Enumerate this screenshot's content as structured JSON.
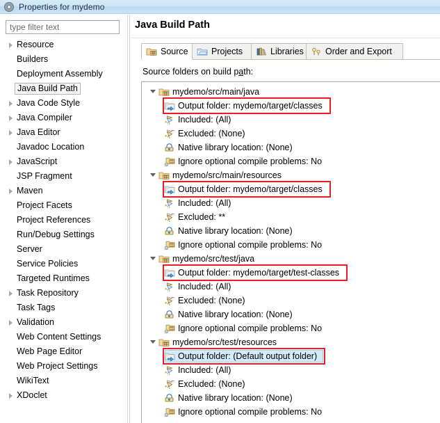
{
  "window": {
    "title": "Properties for mydemo",
    "icon": "properties-gear-icon"
  },
  "sidebar": {
    "filter": {
      "placeholder": "type filter text",
      "value": ""
    },
    "items": [
      {
        "label": "Resource",
        "expandable": true,
        "selected": false
      },
      {
        "label": "Builders",
        "expandable": false,
        "selected": false
      },
      {
        "label": "Deployment Assembly",
        "expandable": false,
        "selected": false
      },
      {
        "label": "Java Build Path",
        "expandable": false,
        "selected": true
      },
      {
        "label": "Java Code Style",
        "expandable": true,
        "selected": false
      },
      {
        "label": "Java Compiler",
        "expandable": true,
        "selected": false
      },
      {
        "label": "Java Editor",
        "expandable": true,
        "selected": false
      },
      {
        "label": "Javadoc Location",
        "expandable": false,
        "selected": false
      },
      {
        "label": "JavaScript",
        "expandable": true,
        "selected": false
      },
      {
        "label": "JSP Fragment",
        "expandable": false,
        "selected": false
      },
      {
        "label": "Maven",
        "expandable": true,
        "selected": false
      },
      {
        "label": "Project Facets",
        "expandable": false,
        "selected": false
      },
      {
        "label": "Project References",
        "expandable": false,
        "selected": false
      },
      {
        "label": "Run/Debug Settings",
        "expandable": false,
        "selected": false
      },
      {
        "label": "Server",
        "expandable": false,
        "selected": false
      },
      {
        "label": "Service Policies",
        "expandable": false,
        "selected": false
      },
      {
        "label": "Targeted Runtimes",
        "expandable": false,
        "selected": false
      },
      {
        "label": "Task Repository",
        "expandable": true,
        "selected": false
      },
      {
        "label": "Task Tags",
        "expandable": false,
        "selected": false
      },
      {
        "label": "Validation",
        "expandable": true,
        "selected": false
      },
      {
        "label": "Web Content Settings",
        "expandable": false,
        "selected": false
      },
      {
        "label": "Web Page Editor",
        "expandable": false,
        "selected": false
      },
      {
        "label": "Web Project Settings",
        "expandable": false,
        "selected": false
      },
      {
        "label": "WikiText",
        "expandable": false,
        "selected": false
      },
      {
        "label": "XDoclet",
        "expandable": true,
        "selected": false
      }
    ]
  },
  "page": {
    "title": "Java Build Path",
    "tabs": [
      {
        "label": "Source",
        "icon": "source-folder-icon",
        "active": true
      },
      {
        "label": "Projects",
        "icon": "project-folder-icon",
        "active": false
      },
      {
        "label": "Libraries",
        "icon": "library-books-icon",
        "active": false
      },
      {
        "label": "Order and Export",
        "icon": "order-export-icon",
        "active": false
      }
    ],
    "section_label_pre": "Source folders on build p",
    "section_label_mnemonic": "a",
    "section_label_post": "th:",
    "tree": [
      {
        "label": "mydemo/src/main/java",
        "icon": "source-folder-icon",
        "level": 0,
        "expanded": true,
        "children": [
          {
            "label": "Output folder: mydemo/target/classes",
            "icon": "output-folder-icon",
            "highlight": true,
            "selected": false
          },
          {
            "label": "Included: (All)",
            "icon": "included-icon",
            "highlight": false,
            "selected": false
          },
          {
            "label": "Excluded: (None)",
            "icon": "excluded-icon",
            "highlight": false,
            "selected": false
          },
          {
            "label": "Native library location: (None)",
            "icon": "native-library-icon",
            "highlight": false,
            "selected": false
          },
          {
            "label": "Ignore optional compile problems: No",
            "icon": "compile-problems-icon",
            "highlight": false,
            "selected": false
          }
        ]
      },
      {
        "label": "mydemo/src/main/resources",
        "icon": "source-folder-icon",
        "level": 0,
        "expanded": true,
        "children": [
          {
            "label": "Output folder: mydemo/target/classes",
            "icon": "output-folder-icon",
            "highlight": true,
            "selected": false
          },
          {
            "label": "Included: (All)",
            "icon": "included-icon",
            "highlight": false,
            "selected": false
          },
          {
            "label": "Excluded: **",
            "icon": "excluded-icon",
            "highlight": false,
            "selected": false
          },
          {
            "label": "Native library location: (None)",
            "icon": "native-library-icon",
            "highlight": false,
            "selected": false
          },
          {
            "label": "Ignore optional compile problems: No",
            "icon": "compile-problems-icon",
            "highlight": false,
            "selected": false
          }
        ]
      },
      {
        "label": "mydemo/src/test/java",
        "icon": "source-folder-icon",
        "level": 0,
        "expanded": true,
        "children": [
          {
            "label": "Output folder: mydemo/target/test-classes",
            "icon": "output-folder-icon",
            "highlight": true,
            "selected": false
          },
          {
            "label": "Included: (All)",
            "icon": "included-icon",
            "highlight": false,
            "selected": false
          },
          {
            "label": "Excluded: (None)",
            "icon": "excluded-icon",
            "highlight": false,
            "selected": false
          },
          {
            "label": "Native library location: (None)",
            "icon": "native-library-icon",
            "highlight": false,
            "selected": false
          },
          {
            "label": "Ignore optional compile problems: No",
            "icon": "compile-problems-icon",
            "highlight": false,
            "selected": false
          }
        ]
      },
      {
        "label": "mydemo/src/test/resources",
        "icon": "source-folder-icon",
        "level": 0,
        "expanded": true,
        "children": [
          {
            "label": "Output folder: (Default output folder)",
            "icon": "output-folder-icon",
            "highlight": true,
            "selected": true
          },
          {
            "label": "Included: (All)",
            "icon": "included-icon",
            "highlight": false,
            "selected": false
          },
          {
            "label": "Excluded: (None)",
            "icon": "excluded-icon",
            "highlight": false,
            "selected": false
          },
          {
            "label": "Native library location: (None)",
            "icon": "native-library-icon",
            "highlight": false,
            "selected": false
          },
          {
            "label": "Ignore optional compile problems: No",
            "icon": "compile-problems-icon",
            "highlight": false,
            "selected": false
          }
        ]
      }
    ]
  },
  "colors": {
    "annotation_red": "#ec1c24",
    "titlebar_blue": "#cfe5f6",
    "selection_blue": "#d4ebfb"
  }
}
